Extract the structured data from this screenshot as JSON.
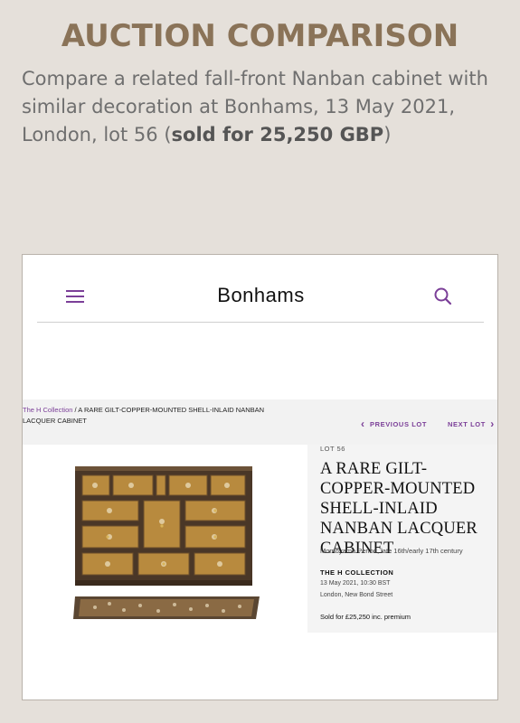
{
  "heading": "AUCTION COMPARISON",
  "intro": {
    "text_before": "Compare a related fall-front Nanban cabinet with similar decoration at Bonhams, 13 May 2021, London, lot 56 (",
    "price_bold": "sold for 25,250 GBP",
    "text_after": ")"
  },
  "site": {
    "logo": "Bonhams",
    "menu_icon": "hamburger-menu-icon",
    "search_icon": "search-icon",
    "accent_color": "#7b3f98"
  },
  "breadcrumb": {
    "collection_link": "The H Collection",
    "separator": " / ",
    "current": "A RARE GILT-COPPER-MOUNTED SHELL-INLAID NANBAN LACQUER CABINET"
  },
  "lot_nav": {
    "previous": "PREVIOUS LOT",
    "next": "NEXT LOT"
  },
  "lot": {
    "number_label": "LOT 56",
    "title": "A RARE GILT-COPPER-MOUNTED SHELL-INLAID NANBAN LACQUER CABINET",
    "period": "Momoyama Period, late 16th/early 17th century",
    "collection": "THE H COLLECTION",
    "date": "13 May 2021, 10:30 BST",
    "location": "London, New Bond Street",
    "sold": "Sold for £25,250 inc. premium"
  }
}
